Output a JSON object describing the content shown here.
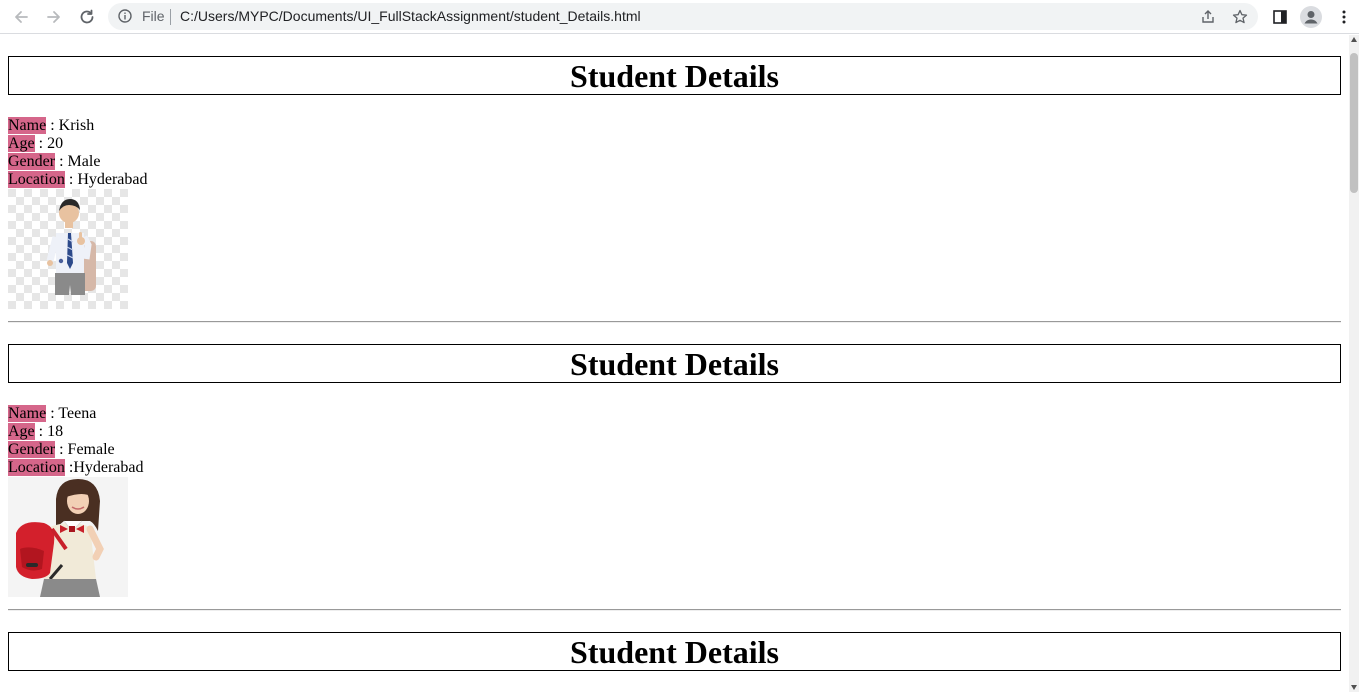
{
  "browser": {
    "file_label": "File",
    "url": "C:/Users/MYPC/Documents/UI_FullStackAssignment/student_Details.html"
  },
  "students": [
    {
      "heading": "Student Details",
      "name_label": "Name",
      "name_value": " : Krish",
      "age_label": "Age",
      "age_value": " : 20",
      "gender_label": "Gender",
      "gender_value": " : Male",
      "location_label": "Location",
      "location_value": " : Hyderabad",
      "photo_icon": "boy-student-photo"
    },
    {
      "heading": "Student Details",
      "name_label": "Name",
      "name_value": " : Teena",
      "age_label": "Age",
      "age_value": " : 18",
      "gender_label": "Gender",
      "gender_value": " : Female",
      "location_label": "Location",
      "location_value": " :Hyderabad",
      "photo_icon": "girl-student-photo"
    },
    {
      "heading": "Student Details"
    }
  ],
  "colors": {
    "label_highlight": "#d5668a"
  }
}
